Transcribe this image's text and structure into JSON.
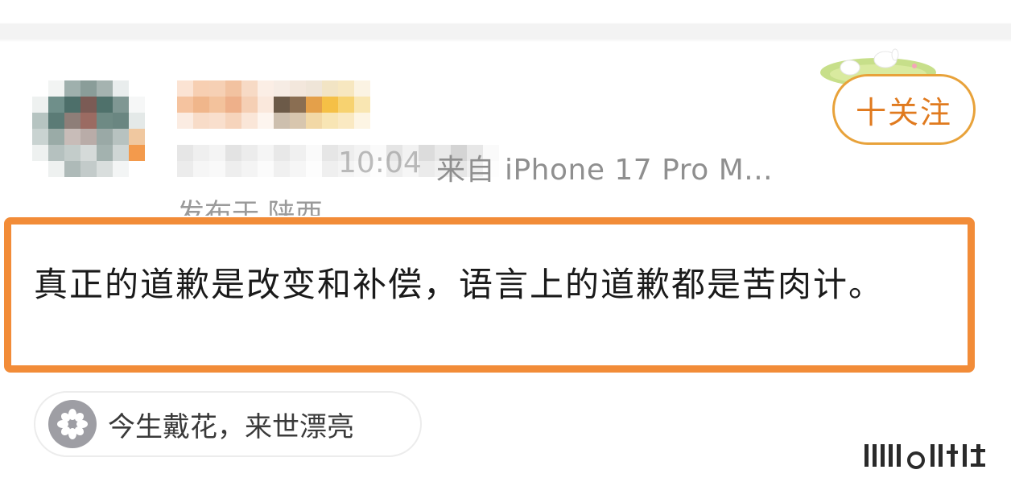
{
  "post": {
    "meta": {
      "time_fragment": "10:04",
      "source_text": "来自 iPhone 17 Pro M...",
      "region_text": "发布于 陕西"
    },
    "follow_label": "十关注",
    "body_text": "真正的道歉是改变和补偿，语言上的道歉都是苦肉计。",
    "topic": {
      "label": "今生戴花，来世漂亮",
      "icon": "flower-icon"
    }
  },
  "colors": {
    "highlight": "#f28c38",
    "follow_border": "#e8a23a",
    "follow_text": "#e07a1e",
    "meta_text": "#8f8f8f"
  },
  "icons": {
    "avatar": "avatar-blurred",
    "follow_decoration": "bunny-grass-decoration-icon",
    "watermark": "watermark-logo-icon"
  }
}
